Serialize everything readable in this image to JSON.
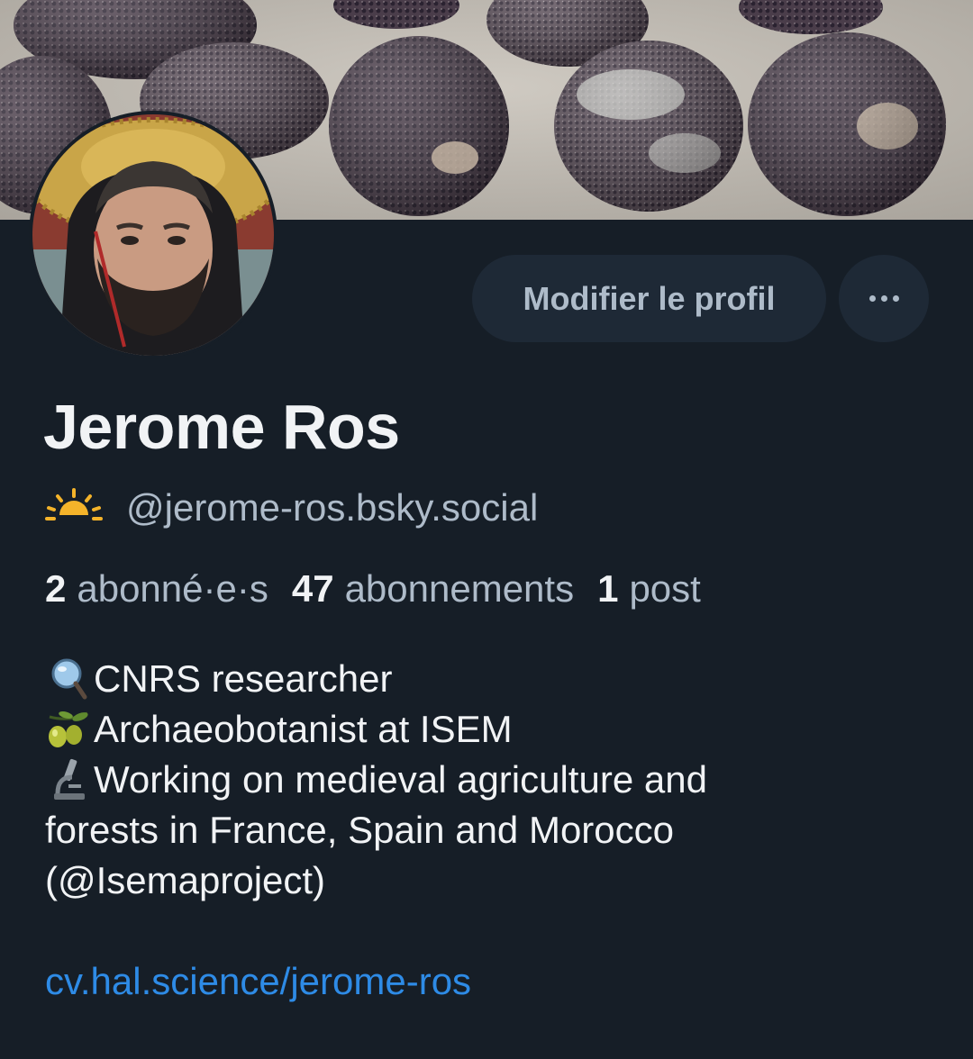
{
  "profile": {
    "display_name": "Jerome Ros",
    "handle": "@jerome-ros.bsky.social",
    "handle_emoji_icon": "sunrise-icon"
  },
  "actions": {
    "edit_label": "Modifier le profil",
    "more_icon": "more-options-icon"
  },
  "stats": [
    {
      "count": "2",
      "label": "abonné·e·s"
    },
    {
      "count": "47",
      "label": "abonnements"
    },
    {
      "count": "1",
      "label": "post"
    }
  ],
  "bio": {
    "lines": [
      {
        "icon": "magnifying-glass-icon",
        "text": "CNRS researcher"
      },
      {
        "icon": "olive-icon",
        "text": "Archaeobotanist at ISEM"
      },
      {
        "icon": "microscope-icon",
        "text": "Working on medieval agriculture and"
      },
      {
        "icon": "",
        "text": "forests in France, Spain and Morocco"
      },
      {
        "icon": "",
        "text": "(@Isemaproject)"
      }
    ],
    "link": "cv.hal.science/jerome-ros"
  },
  "colors": {
    "background": "#161e27",
    "button_bg": "#1e2936",
    "muted_text": "#aebbc9",
    "link": "#2e8be6"
  }
}
